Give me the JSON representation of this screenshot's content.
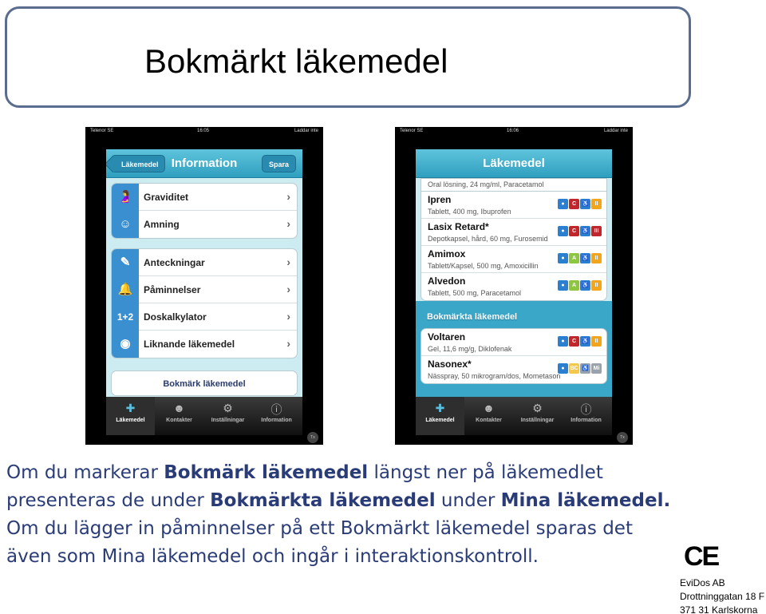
{
  "slide": {
    "title": "Bokmärkt läkemedel"
  },
  "phone_left": {
    "status": {
      "carrier": "Telenor SE",
      "time": "16:05",
      "battery": "Laddar inte"
    },
    "nav": {
      "back": "Läkemedel",
      "title": "Information",
      "save": "Spara"
    },
    "group1": [
      {
        "label": "Graviditet",
        "icon": "pregnancy-icon"
      },
      {
        "label": "Amning",
        "icon": "breastfeeding-icon"
      }
    ],
    "group2": [
      {
        "label": "Anteckningar",
        "icon": "notes-icon"
      },
      {
        "label": "Påminnelser",
        "icon": "bell-icon"
      },
      {
        "label": "Doskalkylator",
        "icon": "dose-calculator-icon",
        "glyph": "1+2"
      },
      {
        "label": "Liknande läkemedel",
        "icon": "pills-icon"
      }
    ],
    "bookmark_button": "Bokmärk läkemedel",
    "tabs": [
      "Läkemedel",
      "Kontakter",
      "Inställningar",
      "Information"
    ],
    "tx": "Tx"
  },
  "phone_right": {
    "status": {
      "carrier": "Telenor SE",
      "time": "16:06",
      "battery": "Laddar inte"
    },
    "nav": {
      "title": "Läkemedel"
    },
    "partial_desc": "Oral lösning, 24 mg/ml, Paracetamol",
    "drugs": [
      {
        "name": "Ipren",
        "desc": "Tablett, 400 mg, Ibuprofen",
        "badges": [
          "C",
          "II"
        ]
      },
      {
        "name": "Lasix Retard*",
        "desc": "Depotkapsel, hård, 60 mg, Furosemid",
        "badges": [
          "C",
          "III"
        ]
      },
      {
        "name": "Amimox",
        "desc": "Tablett/Kapsel, 500 mg, Amoxicillin",
        "badges": [
          "A",
          "II"
        ]
      },
      {
        "name": "Alvedon",
        "desc": "Tablett, 500 mg, Paracetamol",
        "badges": [
          "A",
          "II"
        ]
      }
    ],
    "section_header": "Bokmärkta läkemedel",
    "bookmarked": [
      {
        "name": "Voltaren",
        "desc": "Gel, 11,6 mg/g, Diklofenak",
        "badges": [
          "C",
          "II"
        ]
      },
      {
        "name": "Nasonex*",
        "desc": "Nässpray, 50 mikrogram/dos, Mometason",
        "badges": [
          "BC",
          "Mi"
        ]
      }
    ],
    "tabs": [
      "Läkemedel",
      "Kontakter",
      "Inställningar",
      "Information"
    ],
    "tx": "Tx"
  },
  "caption": {
    "l1a": "Om du markerar ",
    "l1b": "Bokmärk läkemedel",
    "l1c": " längst ner på läkemedlet",
    "l2a": "presenteras de under ",
    "l2b": "Bokmärkta läkemedel",
    "l2c": " under ",
    "l2d": "Mina läkemedel.",
    "l3": "Om du lägger in påminnelser på ett Bokmärkt läkemedel sparas det",
    "l4": "även som Mina läkemedel och ingår i interaktionskontroll."
  },
  "ce": "CE",
  "address": {
    "company": "EviDos AB",
    "street": "Drottninggatan 18 F",
    "city": "371 31 Karlskorna"
  },
  "colors": {
    "accent": "#3a8fd0",
    "nav": "#2f9fbf",
    "caption": "#2a3c78",
    "badge_c": "#c0262c",
    "badge_a": "#8dc63f",
    "badge_yellow": "#f3a61c",
    "badge_blue": "#2a7fd0"
  }
}
